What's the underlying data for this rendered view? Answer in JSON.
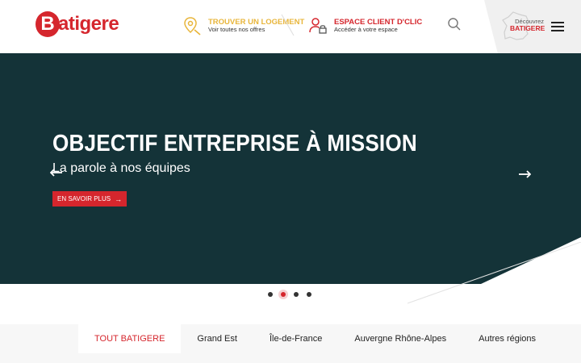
{
  "header": {
    "logo_text": "atigere",
    "logo_letter": "B",
    "find_home": {
      "title": "Trouver un logement",
      "subtitle": "Voir toutes nos offres"
    },
    "client_space": {
      "title": "Espace client d'Clic",
      "subtitle": "Accéder à votre espace"
    },
    "discover": {
      "line1": "Découvrez",
      "line2": "BATIGERE"
    }
  },
  "hero": {
    "title": "OBJECTIF ENTREPRISE À MISSION",
    "subtitle": "La parole à nos équipes",
    "cta_label": "EN SAVOIR PLUS",
    "cta_arrow": "→",
    "background_color": "#143338"
  },
  "carousel": {
    "total": 4,
    "active_index": 1
  },
  "tabs": [
    {
      "label": "TOUT BATIGERE",
      "active": true
    },
    {
      "label": "Grand Est",
      "active": false
    },
    {
      "label": "Île-de-France",
      "active": false
    },
    {
      "label": "Auvergne Rhône-Alpes",
      "active": false
    },
    {
      "label": "Autres régions",
      "active": false
    }
  ],
  "colors": {
    "brand_red": "#d5262d",
    "accent_yellow": "#e8b53a"
  },
  "icons": [
    "location-pin-icon",
    "user-lock-icon",
    "search-icon",
    "france-map-icon",
    "hamburger-menu-icon",
    "arrow-left-icon",
    "arrow-right-icon"
  ]
}
